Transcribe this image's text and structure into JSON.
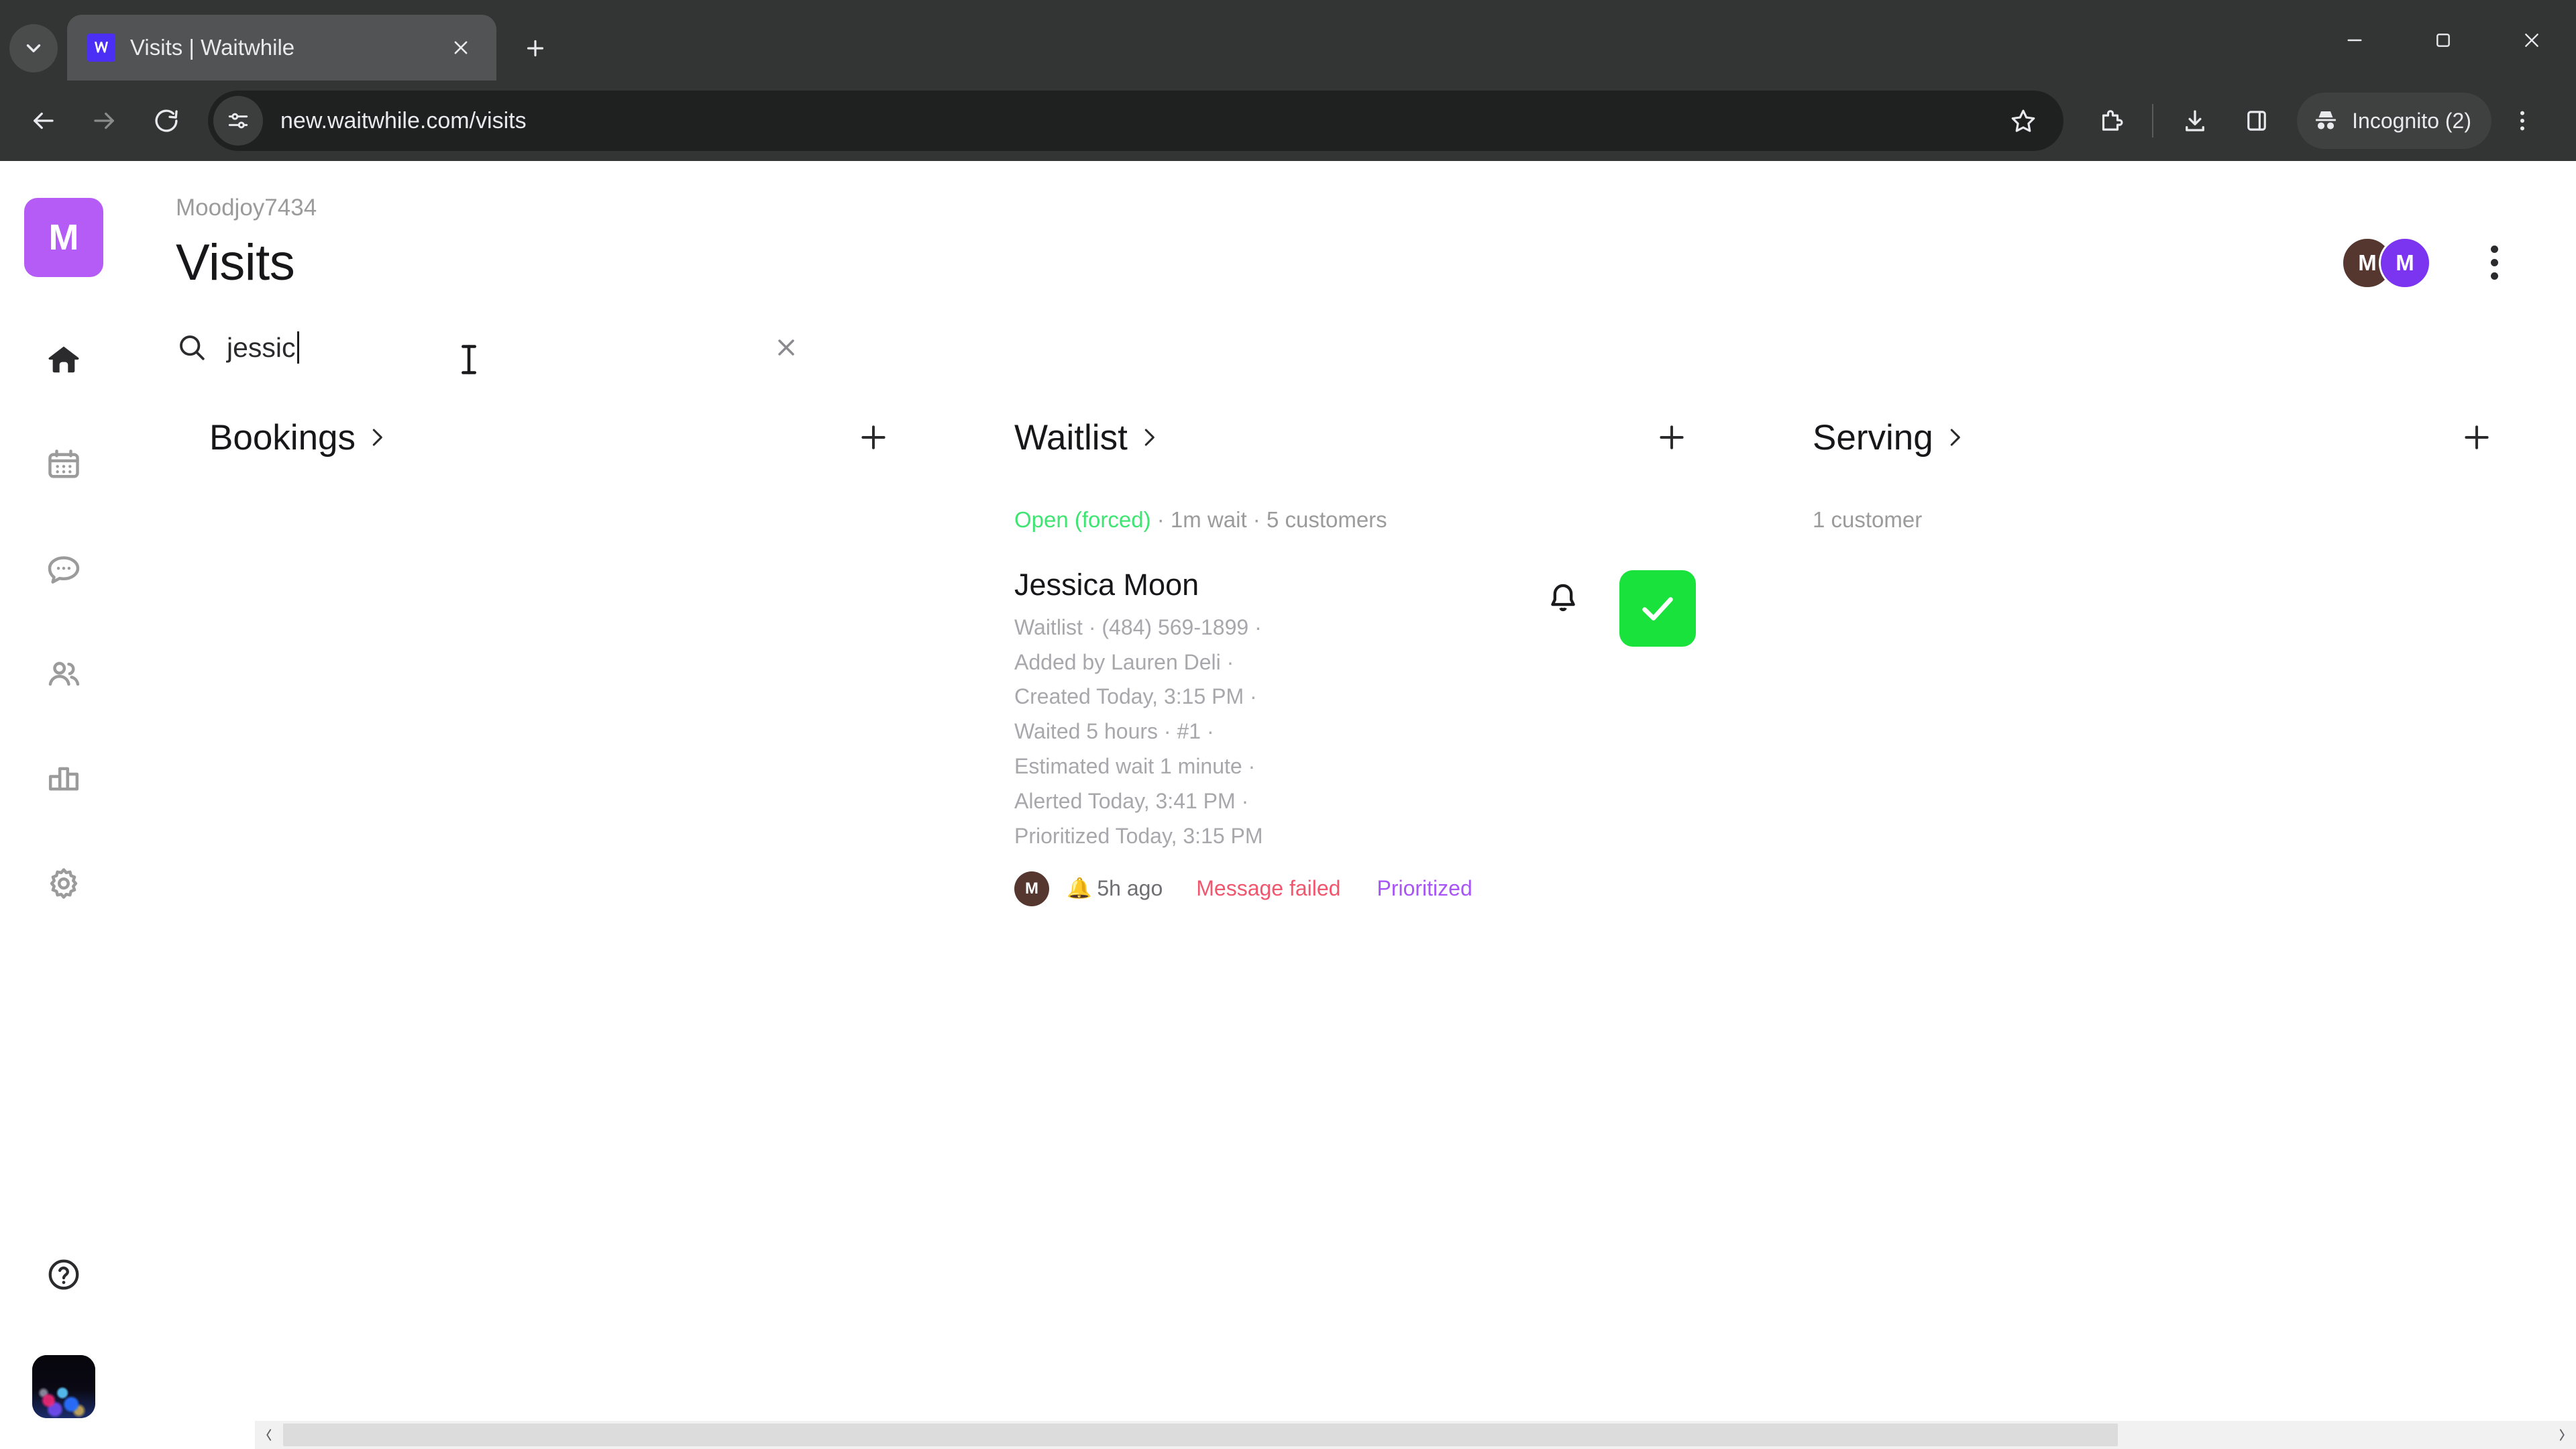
{
  "browser": {
    "tab": {
      "title": "Visits | Waitwhile",
      "favicon": "waitwhile-logo-icon"
    },
    "new_tab_label": "+",
    "url": "new.waitwhile.com/visits",
    "profile_label": "Incognito (2)",
    "icons": {
      "tab_search": "chevron-down-icon",
      "back": "back-arrow-icon",
      "forward": "forward-arrow-icon",
      "reload": "reload-icon",
      "site_info": "page-settings-icon",
      "bookmark": "star-icon",
      "extensions": "extensions-icon",
      "downloads": "download-icon",
      "side_panel": "side-panel-icon",
      "incognito": "incognito-icon",
      "menu": "three-dot-menu-icon",
      "minimize": "minimize-icon",
      "maximize": "maximize-icon",
      "close": "window-close-icon"
    }
  },
  "sidebar": {
    "org_initial": "M",
    "items": [
      {
        "name": "home",
        "icon": "home-icon",
        "active": true
      },
      {
        "name": "calendar",
        "icon": "calendar-icon",
        "active": false
      },
      {
        "name": "messages",
        "icon": "chat-bubble-icon",
        "active": false
      },
      {
        "name": "customers",
        "icon": "people-icon",
        "active": false
      },
      {
        "name": "analytics",
        "icon": "bar-chart-icon",
        "active": false
      },
      {
        "name": "settings",
        "icon": "gear-icon",
        "active": false
      }
    ],
    "help_icon": "question-circle-icon",
    "user_avatar": "user-photo-avatar"
  },
  "header": {
    "org_name": "Moodjoy7434",
    "page_title": "Visits",
    "avatars": [
      {
        "initial": "M",
        "color": "#55372f"
      },
      {
        "initial": "M",
        "color": "#7b34ef"
      }
    ],
    "menu_icon": "three-dot-menu-icon"
  },
  "search": {
    "icon": "search-icon",
    "value": "jessic",
    "clear_icon": "close-icon",
    "cursor_icon": "text-cursor-icon"
  },
  "columns": [
    {
      "title": "Bookings",
      "chevron": "chevron-right-icon",
      "add_icon": "plus-icon",
      "status": null,
      "cards": []
    },
    {
      "title": "Waitlist",
      "chevron": "chevron-right-icon",
      "add_icon": "plus-icon",
      "status": {
        "state": "Open (forced)",
        "state_color": "#3ee572",
        "rest": " · 1m wait · 5 customers"
      },
      "cards": [
        {
          "name": "Jessica Moon",
          "meta": "Waitlist · (484) 569-1899 · Added by Lauren Deli · Created Today, 3:15 PM · Waited 5 hours · #1 · Estimated wait 1 minute · Alerted Today, 3:41 PM · Prioritized Today, 3:15 PM",
          "meta_lines": [
            "Waitlist · (484) 569-1899 ·",
            "Added by Lauren Deli ·",
            "Created Today, 3:15 PM ·",
            "Waited 5 hours · #1 ·",
            "Estimated wait 1 minute ·",
            "Alerted Today, 3:41 PM ·",
            "Prioritized Today, 3:15 PM"
          ],
          "badges": {
            "avatar_initial": "M",
            "time": "5h ago",
            "time_icon": "yellow-bell-icon",
            "message_status": "Message failed",
            "message_status_color": "#f0566e",
            "priority": "Prioritized",
            "priority_color": "#a855f7"
          },
          "actions": {
            "notify_icon": "bell-icon",
            "serve_icon": "checkmark-icon",
            "serve_color": "#19e23c"
          }
        }
      ]
    },
    {
      "title": "Serving",
      "chevron": "chevron-right-icon",
      "add_icon": "plus-icon",
      "status": {
        "state": null,
        "state_color": null,
        "rest": "1 customer"
      },
      "cards": []
    }
  ],
  "scrollbar": {
    "left_arrow": "scroll-left-arrow-icon",
    "right_arrow": "scroll-right-arrow-icon"
  }
}
